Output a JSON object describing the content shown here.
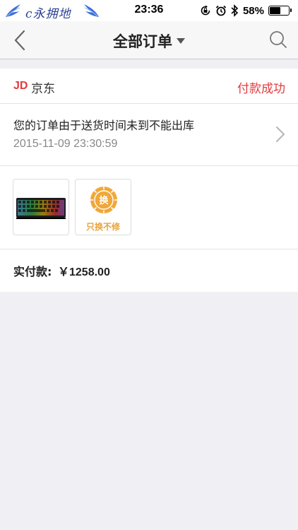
{
  "status_bar": {
    "carrier_text": "c永拥地",
    "time": "23:36",
    "battery_percent_text": "58%",
    "battery_level": 0.58,
    "icons": [
      "orientation-lock-icon",
      "alarm-icon",
      "bluetooth-icon",
      "battery-icon"
    ]
  },
  "nav": {
    "title": "全部订单",
    "back_icon": "chevron-left-icon",
    "search_icon": "search-icon",
    "dropdown_icon": "caret-down-icon"
  },
  "order": {
    "store_logo": "JD",
    "store_name": "京东",
    "status": "付款成功",
    "message": "您的订单由于送货时间未到不能出库",
    "time": "2015-11-09 23:30:59",
    "items": [
      {
        "type": "product",
        "icon": "keyboard-image"
      },
      {
        "type": "badge",
        "icon": "exchange-icon",
        "glyph": "换",
        "label": "只换不修"
      }
    ],
    "total_label": "实付款:",
    "total_amount": "￥1258.00"
  },
  "colors": {
    "accent_red": "#e4393c",
    "badge_orange": "#f0a83a",
    "background": "#efeff4"
  }
}
